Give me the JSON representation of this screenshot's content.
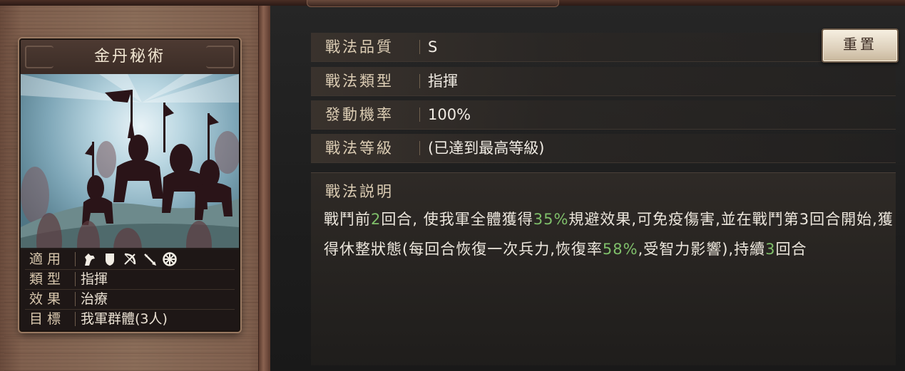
{
  "card": {
    "title": "金丹秘術",
    "info": {
      "apply_key": "適用",
      "apply_icons": [
        "cavalry-icon",
        "shield-infantry-icon",
        "bow-icon",
        "spear-icon",
        "siege-wheel-icon"
      ],
      "type_key": "類型",
      "type_value": "指揮",
      "effect_key": "效果",
      "effect_value": "治療",
      "target_key": "目標",
      "target_value": "我軍群體(3人)"
    }
  },
  "details": {
    "quality_key": "戰法品質",
    "quality_value": "S",
    "type_key": "戰法類型",
    "type_value": "指揮",
    "rate_key": "發動機率",
    "rate_value": "100%",
    "level_key": "戰法等級",
    "level_value": "(已達到最高等級)"
  },
  "reset_label": "重置",
  "description": {
    "title": "戰法説明",
    "seg1": "戰鬥前",
    "hl1": "2",
    "seg2": "回合, 使我軍全體獲得",
    "hl2": "35%",
    "seg3": "規避效果,可免疫傷害,並在戰鬥第3回合開始,獲得休整狀態(每回合恢復一次兵力,恢復率",
    "hl3": "58%",
    "seg4": ",受智力影響),持續",
    "hl4": "3",
    "seg5": "回合"
  },
  "colors": {
    "highlight": "#7fbf6a",
    "label": "#dccdb4",
    "value": "#f0ebe3"
  }
}
